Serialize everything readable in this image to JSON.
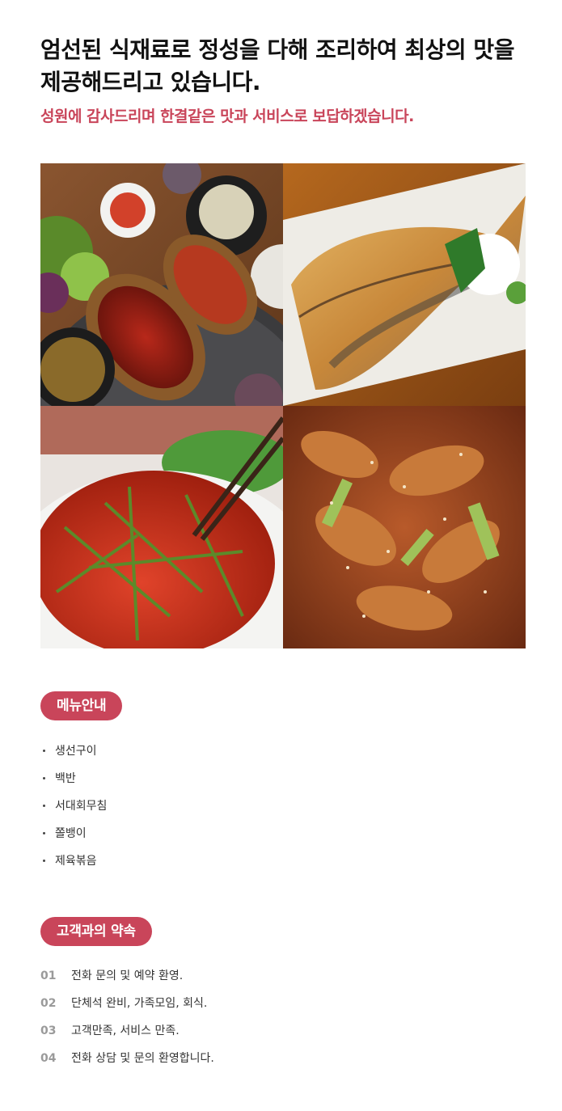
{
  "intro": {
    "headline": "엄선된 식재료로 정성을 다해 조리하여 최상의 맛을 제공해드리고 있습니다.",
    "subline": "성원에 감사드리며 한결같은 맛과 서비스로 보답하겠습니다."
  },
  "gallery": {
    "photos": [
      {
        "icon": "korean-table-setting-photo"
      },
      {
        "icon": "grilled-fish-photo"
      },
      {
        "icon": "spicy-vegetable-salad-photo"
      },
      {
        "icon": "stir-fried-pork-photo"
      }
    ]
  },
  "menu": {
    "title": "메뉴안내",
    "items": [
      "생선구이",
      "백반",
      "서대회무침",
      "쫄뱅이",
      "제육볶음"
    ]
  },
  "promise": {
    "title": "고객과의 약속",
    "items": [
      {
        "num": "01",
        "text": "전화 문의 및 예약 환영."
      },
      {
        "num": "02",
        "text": "단체석 완비, 가족모임, 회식."
      },
      {
        "num": "03",
        "text": "고객만족, 서비스 만족."
      },
      {
        "num": "04",
        "text": "전화 상담 및 문의 환영합니다."
      }
    ]
  },
  "colors": {
    "accent": "#c9455a",
    "number_gray": "#9a9a9a"
  }
}
